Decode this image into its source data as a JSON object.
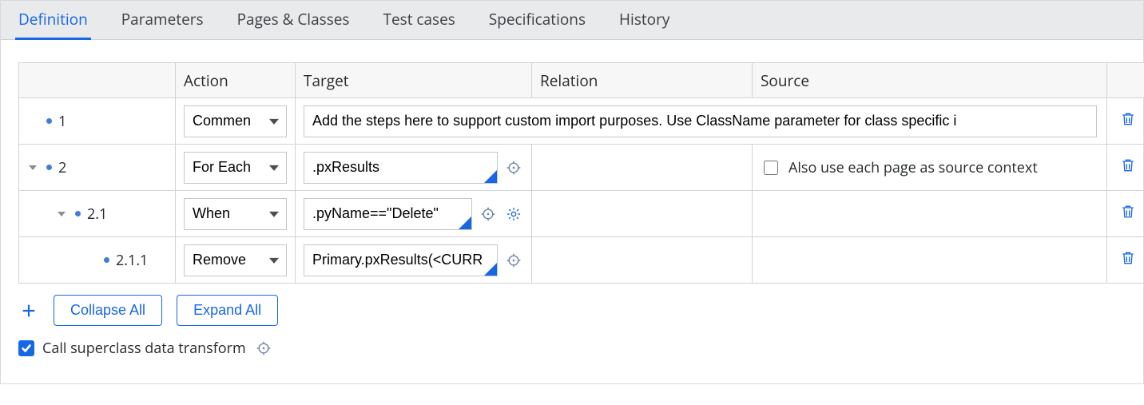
{
  "tabs": {
    "definition": "Definition",
    "parameters": "Parameters",
    "pages": "Pages & Classes",
    "tests": "Test cases",
    "specs": "Specifications",
    "history": "History"
  },
  "headers": {
    "action": "Action",
    "target": "Target",
    "relation": "Relation",
    "source": "Source"
  },
  "rows": {
    "r1": {
      "num": "1",
      "action": "Commen",
      "comment": "Add the steps here to support custom import purposes. Use ClassName parameter for class specific i"
    },
    "r2": {
      "num": "2",
      "action": "For Each",
      "target": ".pxResults",
      "source_checkbox_label": "Also use each page as source context",
      "source_checked": false
    },
    "r21": {
      "num": "2.1",
      "action": "When",
      "target": ".pyName==\"Delete\""
    },
    "r211": {
      "num": "2.1.1",
      "action": "Remove",
      "target": "Primary.pxResults(<CURR"
    }
  },
  "buttons": {
    "collapse": "Collapse All",
    "expand": "Expand All"
  },
  "superclass": {
    "label": "Call superclass data transform",
    "checked": true
  }
}
